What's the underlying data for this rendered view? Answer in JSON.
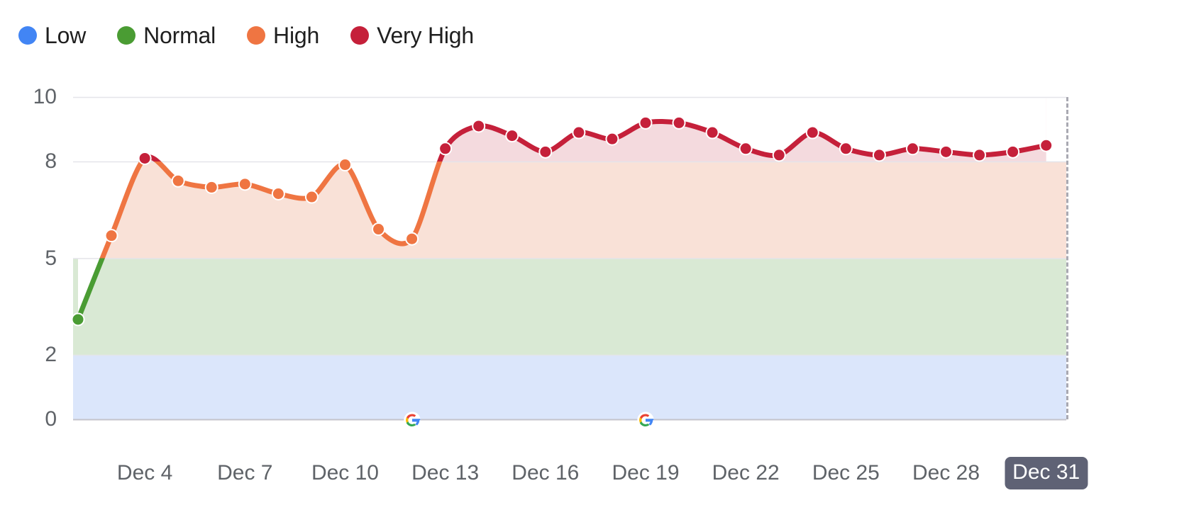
{
  "legend": {
    "items": [
      {
        "label": "Low",
        "color": "#4285f4"
      },
      {
        "label": "Normal",
        "color": "#4a9c33"
      },
      {
        "label": "High",
        "color": "#ef7542"
      },
      {
        "label": "Very High",
        "color": "#c5203a"
      }
    ]
  },
  "axis": {
    "y_ticks": [
      "10",
      "8",
      "5",
      "2",
      "0"
    ],
    "x_ticks": [
      "Dec 4",
      "Dec 7",
      "Dec 10",
      "Dec 13",
      "Dec 16",
      "Dec 19",
      "Dec 22",
      "Dec 25",
      "Dec 28",
      "Dec 31"
    ],
    "x_highlight": "Dec 31"
  },
  "markers": [
    {
      "name": "google-icon",
      "x_value": 10
    },
    {
      "name": "google-icon",
      "x_value": 17
    }
  ],
  "chart_data": {
    "type": "area",
    "title": "",
    "xlabel": "",
    "ylabel": "",
    "ylim": [
      0,
      10
    ],
    "y_ticks": [
      10,
      8,
      5,
      2,
      0
    ],
    "grid": true,
    "legend_position": "top-left",
    "x": [
      "Dec 2",
      "Dec 3",
      "Dec 4",
      "Dec 5",
      "Dec 6",
      "Dec 7",
      "Dec 8",
      "Dec 9",
      "Dec 10",
      "Dec 11",
      "Dec 12",
      "Dec 13",
      "Dec 14",
      "Dec 15",
      "Dec 16",
      "Dec 17",
      "Dec 18",
      "Dec 19",
      "Dec 20",
      "Dec 21",
      "Dec 22",
      "Dec 23",
      "Dec 24",
      "Dec 25",
      "Dec 26",
      "Dec 27",
      "Dec 28",
      "Dec 29",
      "Dec 30",
      "Dec 31"
    ],
    "values": [
      3.1,
      5.7,
      8.1,
      7.4,
      7.2,
      7.3,
      7.0,
      6.9,
      7.9,
      5.9,
      5.6,
      8.4,
      9.1,
      8.8,
      8.3,
      8.9,
      8.7,
      9.2,
      9.2,
      8.9,
      8.4,
      8.2,
      8.9,
      8.4,
      8.2,
      8.4,
      8.3,
      8.2,
      8.3,
      8.5
    ],
    "bands": [
      {
        "name": "Low",
        "range": [
          0,
          2
        ],
        "fill": "#dbe6fb",
        "line": "#4285f4"
      },
      {
        "name": "Normal",
        "range": [
          2,
          5
        ],
        "fill": "#d9e9d4",
        "line": "#4a9c33"
      },
      {
        "name": "High",
        "range": [
          5,
          8
        ],
        "fill": "#f9e1d7",
        "line": "#ef7542"
      },
      {
        "name": "Very High",
        "range": [
          8,
          10
        ],
        "fill": "#f4dade",
        "line": "#c5203a"
      }
    ]
  }
}
